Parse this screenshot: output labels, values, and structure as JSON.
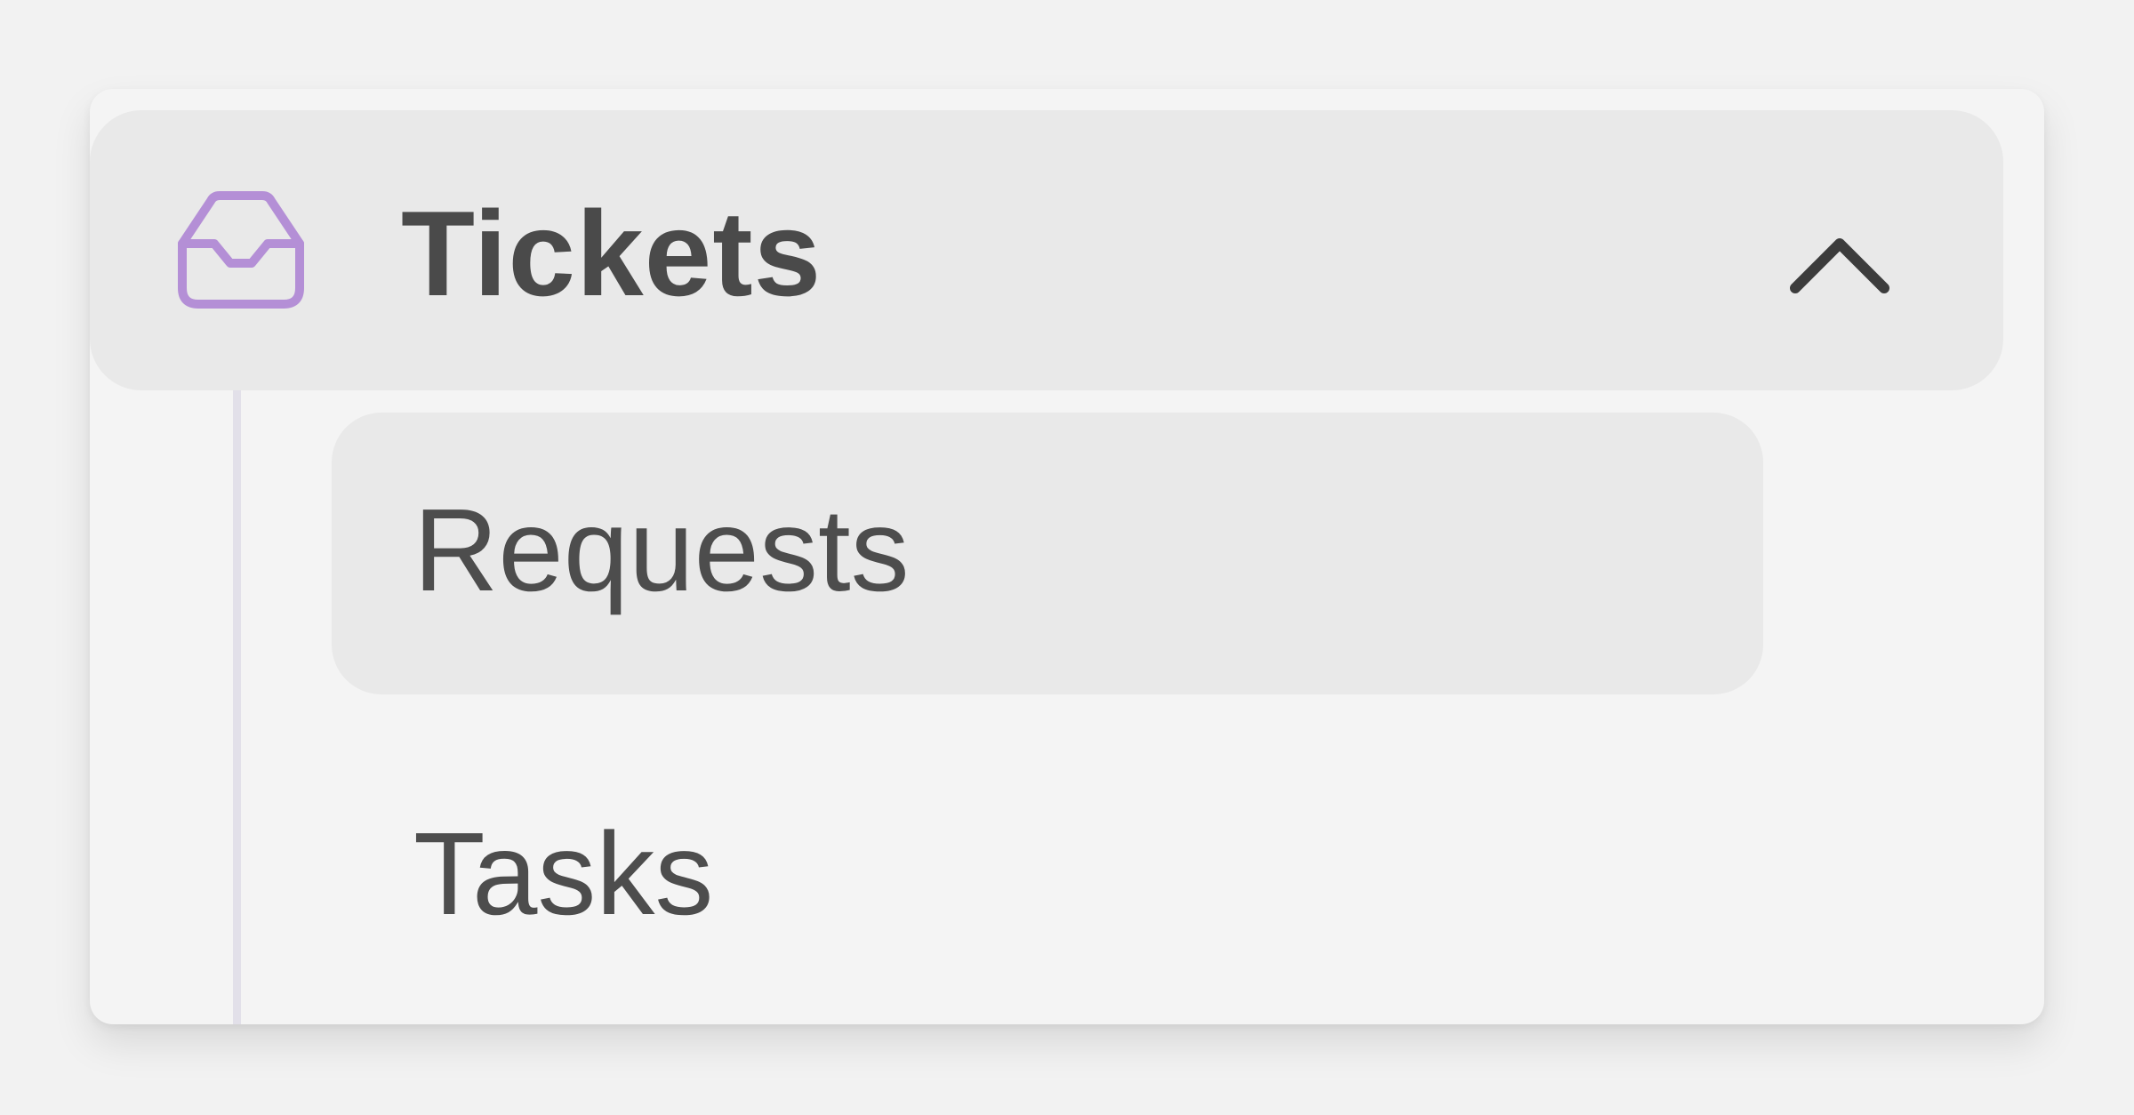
{
  "nav_group": {
    "label": "Tickets",
    "icon": "inbox-icon",
    "toggle_icon": "chevron-up-icon",
    "expanded": true,
    "icon_color": "#b48fd6",
    "items": [
      {
        "label": "Requests",
        "active": true
      },
      {
        "label": "Tasks",
        "active": false
      }
    ]
  }
}
